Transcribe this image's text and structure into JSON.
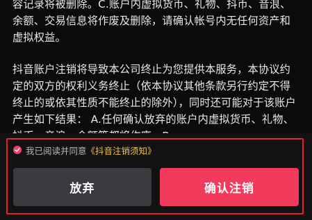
{
  "content": {
    "paragraph1": "容记录将被删除。C.账户内虚拟货币、礼物、抖币、音浪、余额、交易信息将作废及删除，请确认帐号内无任何资产和虚拟权益。",
    "paragraph2": "抖音账户注销将导致本公司终止为您提供本服务，本协议约定的双方的权利义务终止（依本协议其他条款另行约定不得终止的或依其性质不能终止的除外），同时还可能对于该账户产生如下结果： A.任何确认放弃的账户内虚拟货币、礼物、抖币、音浪、余额等都将作废。B."
  },
  "agreement": {
    "checked": true,
    "text": "我已阅读并同意",
    "link": "《抖音注销须知》"
  },
  "buttons": {
    "abandon": "放弃",
    "confirm": "确认注销"
  },
  "colors": {
    "confirm": "#f23b5c",
    "abandon": "#3a3a3f",
    "highlight_border": "#e4232a",
    "link": "#f3c24a"
  }
}
